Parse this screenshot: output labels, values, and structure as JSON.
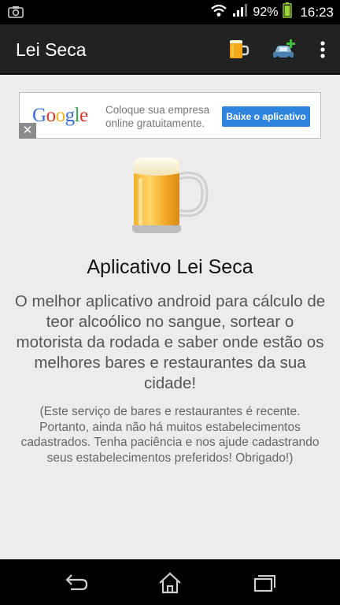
{
  "status_bar": {
    "battery_percent": "92%",
    "time": "16:23",
    "icons": [
      "camera-icon",
      "wifi-icon",
      "signal-icon",
      "battery-icon"
    ]
  },
  "action_bar": {
    "title": "Lei Seca",
    "actions": [
      "beer-mug-icon",
      "car-add-icon",
      "overflow-menu-icon"
    ]
  },
  "ad": {
    "logo": "Google",
    "text": "Coloque sua empresa online gratuitamente.",
    "button_label": "Baixe o aplicativo",
    "close_label": "✕"
  },
  "main": {
    "title": "Aplicativo Lei Seca",
    "description": "O melhor aplicativo android para cálculo de teor alcoólico no sangue, sortear o motorista da rodada e saber onde estão os melhores bares e restaurantes da sua cidade!",
    "note": "(Este serviço de bares e restaurantes é recente. Portanto, ainda não há muitos estabelecimentos cadastrados. Tenha paciência e nos ajude cadastrando seus estabelecimentos preferidos! Obrigado!)"
  },
  "nav_bar": {
    "buttons": [
      "back-icon",
      "home-icon",
      "recents-icon"
    ]
  },
  "colors": {
    "action_bar": "#222222",
    "background": "#ececec",
    "ad_button": "#2f84e0"
  }
}
